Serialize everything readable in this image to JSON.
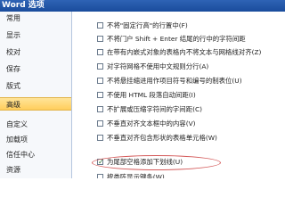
{
  "window": {
    "title": "Word 选项"
  },
  "sidebar": {
    "items": [
      {
        "label": "常用"
      },
      {
        "label": "显示"
      },
      {
        "label": "校对"
      },
      {
        "label": "保存"
      },
      {
        "label": "版式"
      },
      {
        "label": "高级"
      },
      {
        "label": "自定义"
      },
      {
        "label": "加载项"
      },
      {
        "label": "信任中心"
      },
      {
        "label": "资源"
      }
    ],
    "active_index": 5
  },
  "options": [
    {
      "label": "不将\"固定行高\"的行置中(F)",
      "checked": false
    },
    {
      "label": "不将门户 Shift + Enter 结尾的行中的字符间距",
      "checked": false
    },
    {
      "label": "在带有内嵌式对象的表格内不将文本与网格线对齐(Z)",
      "checked": false
    },
    {
      "label": "对字符网格不使用中文规则分行(A)",
      "checked": false
    },
    {
      "label": "不将悬挂缩进用作项目符号和编号的制表位(U)",
      "checked": false
    },
    {
      "label": "不使用 HTML 段落自动间距(I)",
      "checked": false
    },
    {
      "label": "不扩展或压缩字符间的字间距(C)",
      "checked": false
    },
    {
      "label": "不垂直对齐文本框中的内容(V)",
      "checked": false
    },
    {
      "label": "不垂直对齐包含形状的表格单元格(W)",
      "checked": false
    },
    {
      "label": "为尾部空格添加下划线(U)",
      "checked": true
    },
    {
      "label": "按类阵显示键条(W)",
      "checked": false
    }
  ]
}
